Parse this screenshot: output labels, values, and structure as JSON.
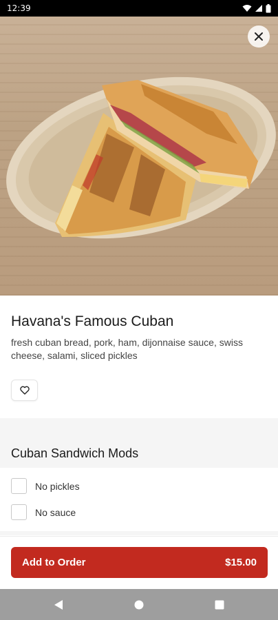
{
  "status_bar": {
    "time": "12:39"
  },
  "item": {
    "title": "Havana's Famous Cuban",
    "description": "fresh cuban bread, pork, ham, dijonnaise sauce, swiss cheese, salami, sliced pickles"
  },
  "mods": {
    "title": "Cuban Sandwich Mods",
    "options": [
      {
        "label": "No pickles",
        "checked": false
      },
      {
        "label": "No sauce",
        "checked": false
      }
    ]
  },
  "order": {
    "add_label": "Add to Order",
    "price": "$15.00"
  },
  "colors": {
    "accent": "#c22a1f",
    "nav_bar": "#9e9e9e"
  },
  "icons": {
    "close": "close-icon",
    "favorite": "heart-icon",
    "nav_back": "back-triangle-icon",
    "nav_home": "home-circle-icon",
    "nav_recents": "recents-square-icon"
  }
}
